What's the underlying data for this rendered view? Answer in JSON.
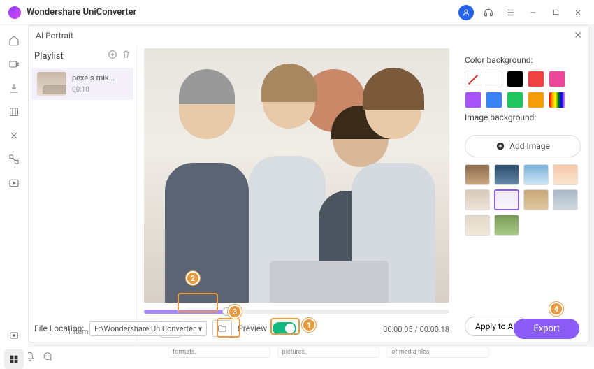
{
  "app": {
    "title": "Wondershare UniConverter"
  },
  "modal": {
    "title": "AI Portrait"
  },
  "playlist": {
    "title": "Playlist",
    "item": {
      "name": "pexels-mik...",
      "duration": "00:18"
    },
    "count": "1 item(s)"
  },
  "player": {
    "time": "00:00:05 / 00:00:18",
    "progress_pct": 27
  },
  "right": {
    "color_label": "Color background:",
    "image_label": "Image background:",
    "add_image": "Add Image",
    "apply_all": "Apply to All",
    "colors": [
      "none",
      "#ffffff",
      "#000000",
      "#ef4444",
      "#ec4899",
      "#a855f7",
      "#3b82f6",
      "#22c55e",
      "#f59e0b",
      "rainbow"
    ],
    "bg_thumbs": [
      "linear-gradient(#8a6a4a,#c8a880)",
      "linear-gradient(#2a4a6a,#6a8aaa)",
      "linear-gradient(#7ab0d8,#cde6f5)",
      "linear-gradient(#f5c8a8,#fae6d0)",
      "linear-gradient(#d8c8b8,#eee4d8)",
      "linear-gradient(#f0e8f5,#faf5fc)",
      "linear-gradient(#c8a878,#e0c8a0)",
      "linear-gradient(#a8b8c8,#d0d8e0)",
      "linear-gradient(#e0d8c8,#f0e8d8)",
      "linear-gradient(#7a9a5a,#a8c888)"
    ],
    "selected_bg": 5
  },
  "footer": {
    "file_location_label": "File Location:",
    "file_location_value": "F:\\Wondershare UniConverter",
    "preview_label": "Preview",
    "export": "Export"
  },
  "frags": {
    "a": "formats.",
    "b": "pictures.",
    "c": "of media files."
  },
  "callouts": {
    "1": "1",
    "2": "2",
    "3": "3",
    "4": "4"
  }
}
